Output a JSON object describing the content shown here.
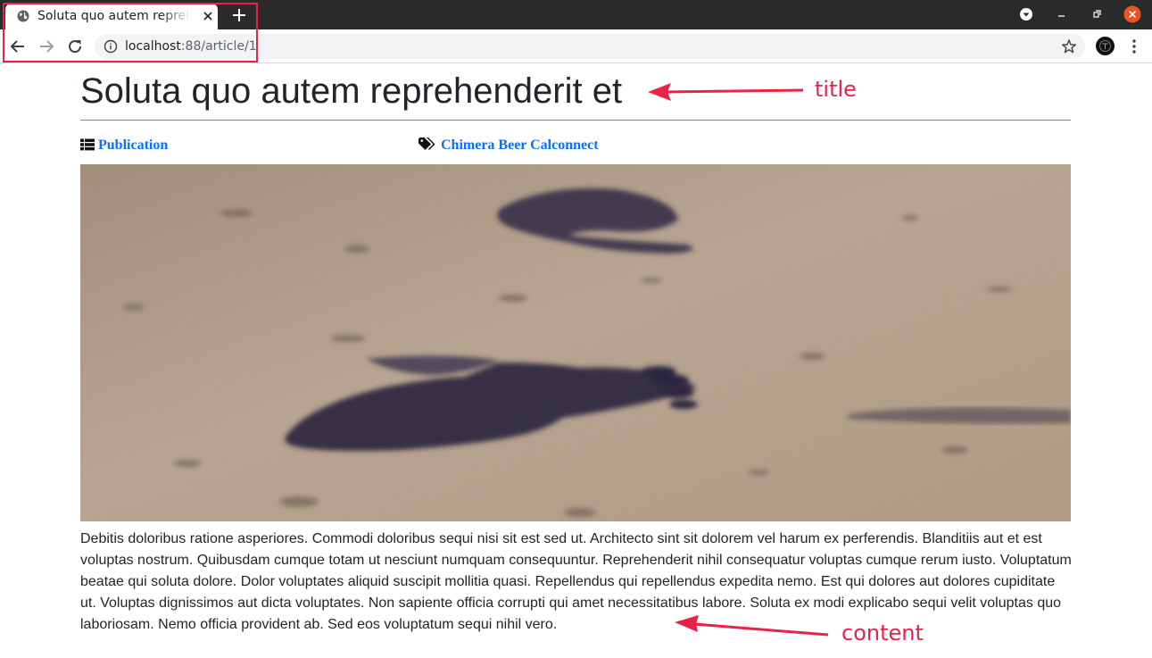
{
  "browser": {
    "tab_title": "Soluta quo autem reprehenderit et",
    "url_host": "localhost",
    "url_rest": ":88/article/1"
  },
  "article": {
    "title": "Soluta quo autem reprehenderit et",
    "category": "Publication",
    "tags": "Chimera Beer Calconnect",
    "content": "Debitis doloribus ratione asperiores. Commodi doloribus sequi nisi sit est sed ut. Architecto sint sit dolorem vel harum ex perferendis. Blanditiis aut et est voluptas nostrum. Quibusdam cumque totam ut nesciunt numquam consequuntur. Reprehenderit nihil consequatur voluptas cumque rerum iusto. Voluptatum beatae qui soluta dolore. Dolor voluptates aliquid suscipit mollitia quasi. Repellendus qui repellendus expedita nemo. Est qui dolores aut dolores cupiditate ut. Voluptas dignissimos aut dicta voluptates. Non sapiente officia corrupti qui amet necessitatibus labore. Soluta ex modi explicabo sequi velit voluptas quo laboriosam. Nemo officia provident ab. Sed eos voluptatum sequi nihil vero."
  },
  "annotations": {
    "title_label": "title",
    "content_label": "content"
  },
  "icons": {
    "tab": "globe-icon",
    "tab_close": "close-icon",
    "new_tab": "plus-icon",
    "back": "back-arrow-icon",
    "forward": "forward-arrow-icon",
    "reload": "reload-icon",
    "site_info": "info-icon",
    "bookmark": "star-icon",
    "menu": "kebab-menu-icon",
    "category": "list-icon",
    "tags": "tags-icon"
  },
  "colors": {
    "link": "#0d6efd",
    "annotation": "#e8234a",
    "close_button": "#e95420"
  }
}
